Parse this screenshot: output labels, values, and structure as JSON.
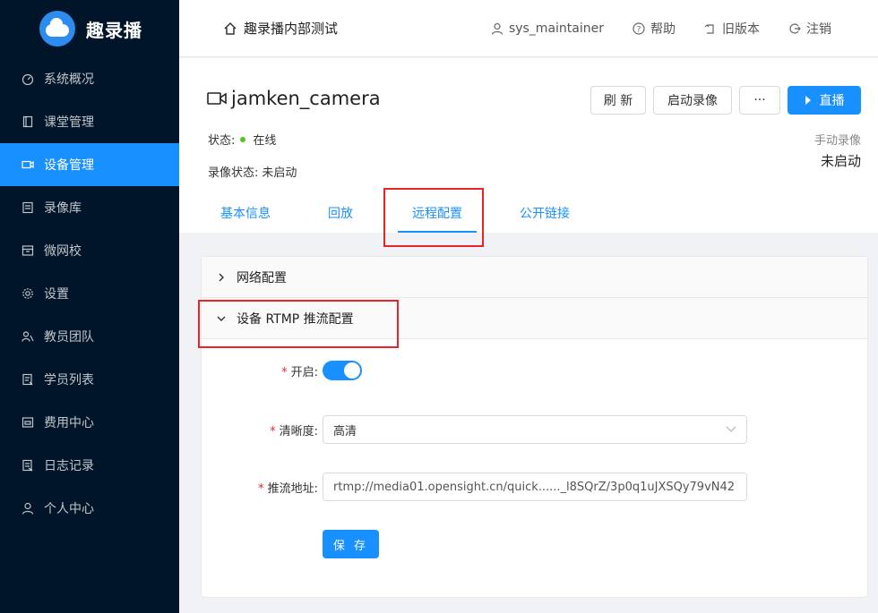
{
  "app": {
    "name": "趣录播"
  },
  "sidebar": {
    "items": [
      {
        "label": "系统概况",
        "icon": "dashboard-icon"
      },
      {
        "label": "课堂管理",
        "icon": "book-icon"
      },
      {
        "label": "设备管理",
        "icon": "camera-icon",
        "active": true
      },
      {
        "label": "录像库",
        "icon": "library-icon"
      },
      {
        "label": "微网校",
        "icon": "school-icon"
      },
      {
        "label": "设置",
        "icon": "gear-icon"
      },
      {
        "label": "教员团队",
        "icon": "team-icon"
      },
      {
        "label": "学员列表",
        "icon": "list-icon"
      },
      {
        "label": "费用中心",
        "icon": "billing-icon"
      },
      {
        "label": "日志记录",
        "icon": "log-icon"
      },
      {
        "label": "个人中心",
        "icon": "user-icon"
      }
    ]
  },
  "header": {
    "title": "趣录播内部测试",
    "user": "sys_maintainer",
    "help": "帮助",
    "old_version": "旧版本",
    "logout": "注销"
  },
  "device": {
    "name": "jamken_camera",
    "status_label": "状态:",
    "status_value": "在线",
    "record_status_label": "录像状态:",
    "record_status_value": "未启动",
    "manual_record_label": "手动录像",
    "manual_record_value": "未启动"
  },
  "actions": {
    "refresh": "刷 新",
    "start_record": "启动录像",
    "more": "···",
    "live": "直播"
  },
  "tabs": [
    {
      "label": "基本信息"
    },
    {
      "label": "回放"
    },
    {
      "label": "远程配置",
      "active": true
    },
    {
      "label": "公开链接"
    }
  ],
  "config": {
    "network_section": "网络配置",
    "rtmp_section": "设备 RTMP 推流配置",
    "enable_label": "开启:",
    "enable_value": true,
    "quality_label": "清晰度:",
    "quality_value": "高清",
    "push_url_label": "推流地址:",
    "push_url_value": "rtmp://media01.opensight.cn/quick......_l8SQrZ/3p0q1uJXSQy79vN42",
    "save_label": "保 存"
  },
  "colors": {
    "sidebar_bg": "#001529",
    "primary": "#1890ff",
    "highlight_box": "#e8242a",
    "online": "#52c41a"
  }
}
